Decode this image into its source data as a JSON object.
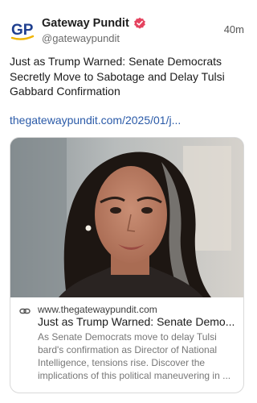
{
  "author": {
    "display_name": "Gateway Pundit",
    "handle": "@gatewaypundit",
    "avatar_text": "GP",
    "verified": true
  },
  "post": {
    "time": "40m",
    "text": "Just as Trump Warned: Senate Democrats Secretly Move to Sabotage and Delay Tulsi Gabbard Confirmation",
    "link_text": "thegatewaypundit.com/2025/01/j..."
  },
  "card": {
    "domain": "www.thegatewaypundit.com",
    "title": "Just as Trump Warned: Senate Demo...",
    "description": "As Senate Democrats move to delay Tulsi bard's confirmation as Director of National Intelligence, tensions rise. Discover the implications of this political maneuvering in ..."
  },
  "icons": {
    "verified": "verified-badge-icon",
    "link": "link-icon"
  },
  "colors": {
    "link": "#2a5aa8",
    "verified_badge": "#e5435f",
    "avatar_text": "#1f3f8f",
    "avatar_accent": "#f0b400"
  }
}
